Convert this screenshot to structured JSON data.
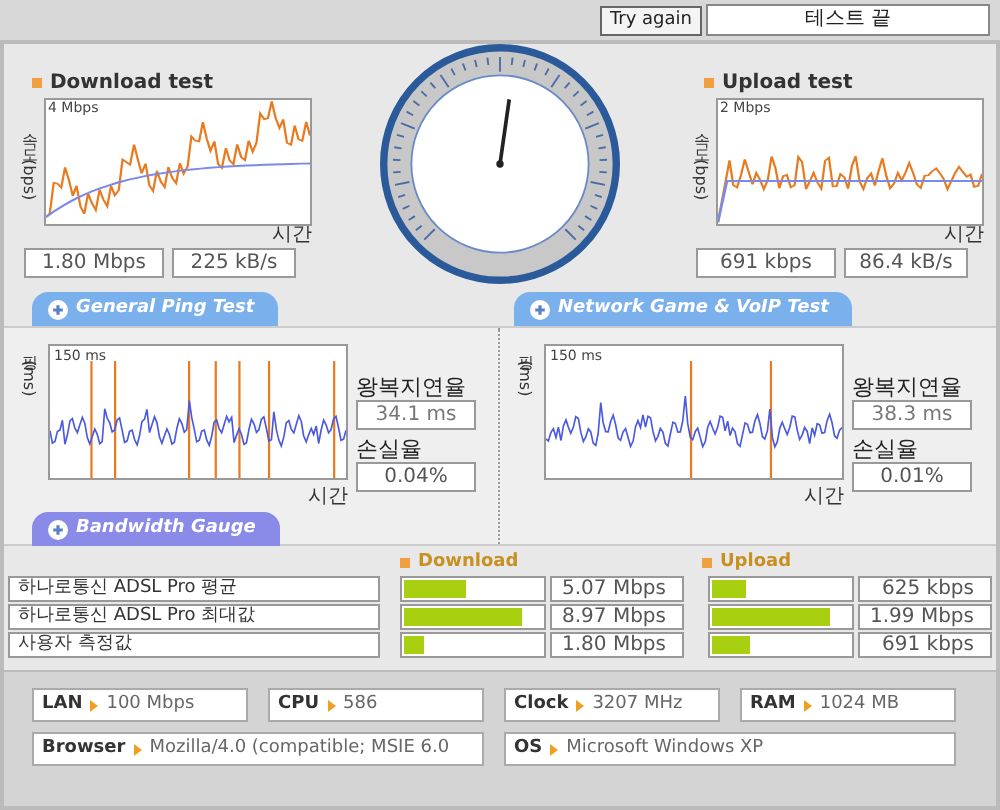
{
  "top_bar": {
    "try_again_button": "Try again",
    "status_field": "테스트 끝"
  },
  "download_test": {
    "title": "Download test",
    "y_axis_label": "속도 (bps)",
    "max_label": "4 Mbps",
    "x_axis_label": "시간",
    "speed": "1.80 Mbps",
    "rate": "225 kB/s"
  },
  "upload_test": {
    "title": "Upload test",
    "y_axis_label": "속도 (bps)",
    "max_label": "2 Mbps",
    "x_axis_label": "시간",
    "speed": "691 kbps",
    "rate": "86.4 kB/s"
  },
  "ping_tests": [
    {
      "header": "General Ping Test",
      "y_axis_label": "핑(ms)",
      "max_label": "150 ms",
      "x_axis_label": "시간",
      "latency_label": "왕복지연율",
      "latency": "34.1 ms",
      "loss_label": "손실율",
      "loss": "0.04%"
    },
    {
      "header": "Network Game & VoIP Test",
      "y_axis_label": "핑(ms)",
      "max_label": "150 ms",
      "x_axis_label": "시간",
      "latency_label": "왕복지연율",
      "latency": "38.3 ms",
      "loss_label": "손실율",
      "loss": "0.01%"
    }
  ],
  "bandwidth_gauge": {
    "header": "Bandwidth Gauge",
    "download_heading": "Download",
    "upload_heading": "Upload",
    "rows": [
      {
        "label": "하나로통신 ADSL Pro 평균",
        "download": {
          "level": 0.45,
          "value": "5.07 Mbps"
        },
        "upload": {
          "level": 0.25,
          "value": "625 kbps"
        }
      },
      {
        "label": "하나로통신 ADSL Pro 최대값",
        "download": {
          "level": 0.85,
          "value": "8.97 Mbps"
        },
        "upload": {
          "level": 0.85,
          "value": "1.99 Mbps"
        }
      },
      {
        "label": "사용자 측정값",
        "download": {
          "level": 0.15,
          "value": "1.80 Mbps"
        },
        "upload": {
          "level": 0.28,
          "value": "691 kbps"
        }
      }
    ]
  },
  "system_info": [
    [
      {
        "label": "LAN",
        "value": "100 Mbps"
      },
      {
        "label": "CPU",
        "value": "586"
      },
      {
        "label": "Clock",
        "value": "3207 MHz"
      },
      {
        "label": "RAM",
        "value": "1024 MB"
      }
    ],
    [
      {
        "label": "Browser",
        "value": "Mozilla/4.0 (compatible; MSIE 6.0"
      },
      {
        "label": "OS",
        "value": "Microsoft Windows XP"
      }
    ]
  ]
}
